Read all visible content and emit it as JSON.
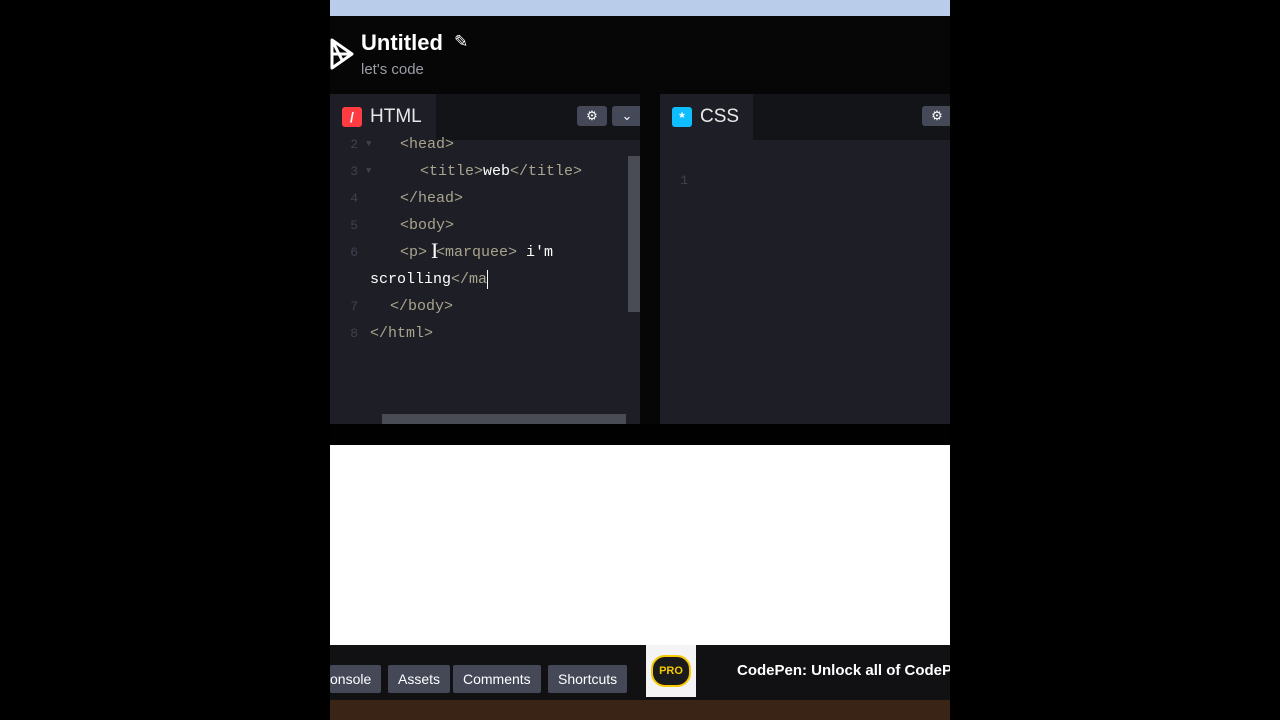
{
  "header": {
    "title": "Untitled",
    "subtitle": "let's code"
  },
  "html_pane": {
    "tab_label": "HTML",
    "tab_icon": "/",
    "accent": "#ff3c41",
    "lines": [
      {
        "num": "2",
        "indent": 3,
        "parts": [
          {
            "t": "<head>",
            "k": "tag"
          }
        ]
      },
      {
        "num": "3",
        "indent": 5,
        "parts": [
          {
            "t": "<title>",
            "k": "tag"
          },
          {
            "t": "web",
            "k": "txt"
          },
          {
            "t": "</title>",
            "k": "tag"
          }
        ]
      },
      {
        "num": "4",
        "indent": 3,
        "parts": [
          {
            "t": "</head>",
            "k": "tag"
          }
        ]
      },
      {
        "num": "5",
        "indent": 3,
        "parts": [
          {
            "t": "<body>",
            "k": "tag"
          }
        ]
      },
      {
        "num": "6",
        "indent": 3,
        "parts": [
          {
            "t": "<p>",
            "k": "tag"
          },
          {
            "t": " ",
            "k": "txt"
          },
          {
            "t": "<marquee>",
            "k": "tag"
          },
          {
            "t": " i'm",
            "k": "txt"
          }
        ]
      },
      {
        "num": "",
        "indent": 0,
        "parts": [
          {
            "t": "scrolling",
            "k": "txt"
          },
          {
            "t": "</ma",
            "k": "tag"
          }
        ]
      },
      {
        "num": "7",
        "indent": 2,
        "parts": [
          {
            "t": "</body>",
            "k": "tag"
          }
        ]
      },
      {
        "num": "8",
        "indent": 0,
        "parts": [
          {
            "t": "</html>",
            "k": "tag"
          }
        ]
      }
    ]
  },
  "css_pane": {
    "tab_label": "CSS",
    "tab_icon": "*",
    "accent": "#0ebeff",
    "line_number": "1"
  },
  "footer": {
    "buttons": [
      "onsole",
      "Assets",
      "Comments",
      "Shortcuts"
    ],
    "pro_label": "PRO",
    "promo": "CodePen: Unlock all of CodePe"
  }
}
